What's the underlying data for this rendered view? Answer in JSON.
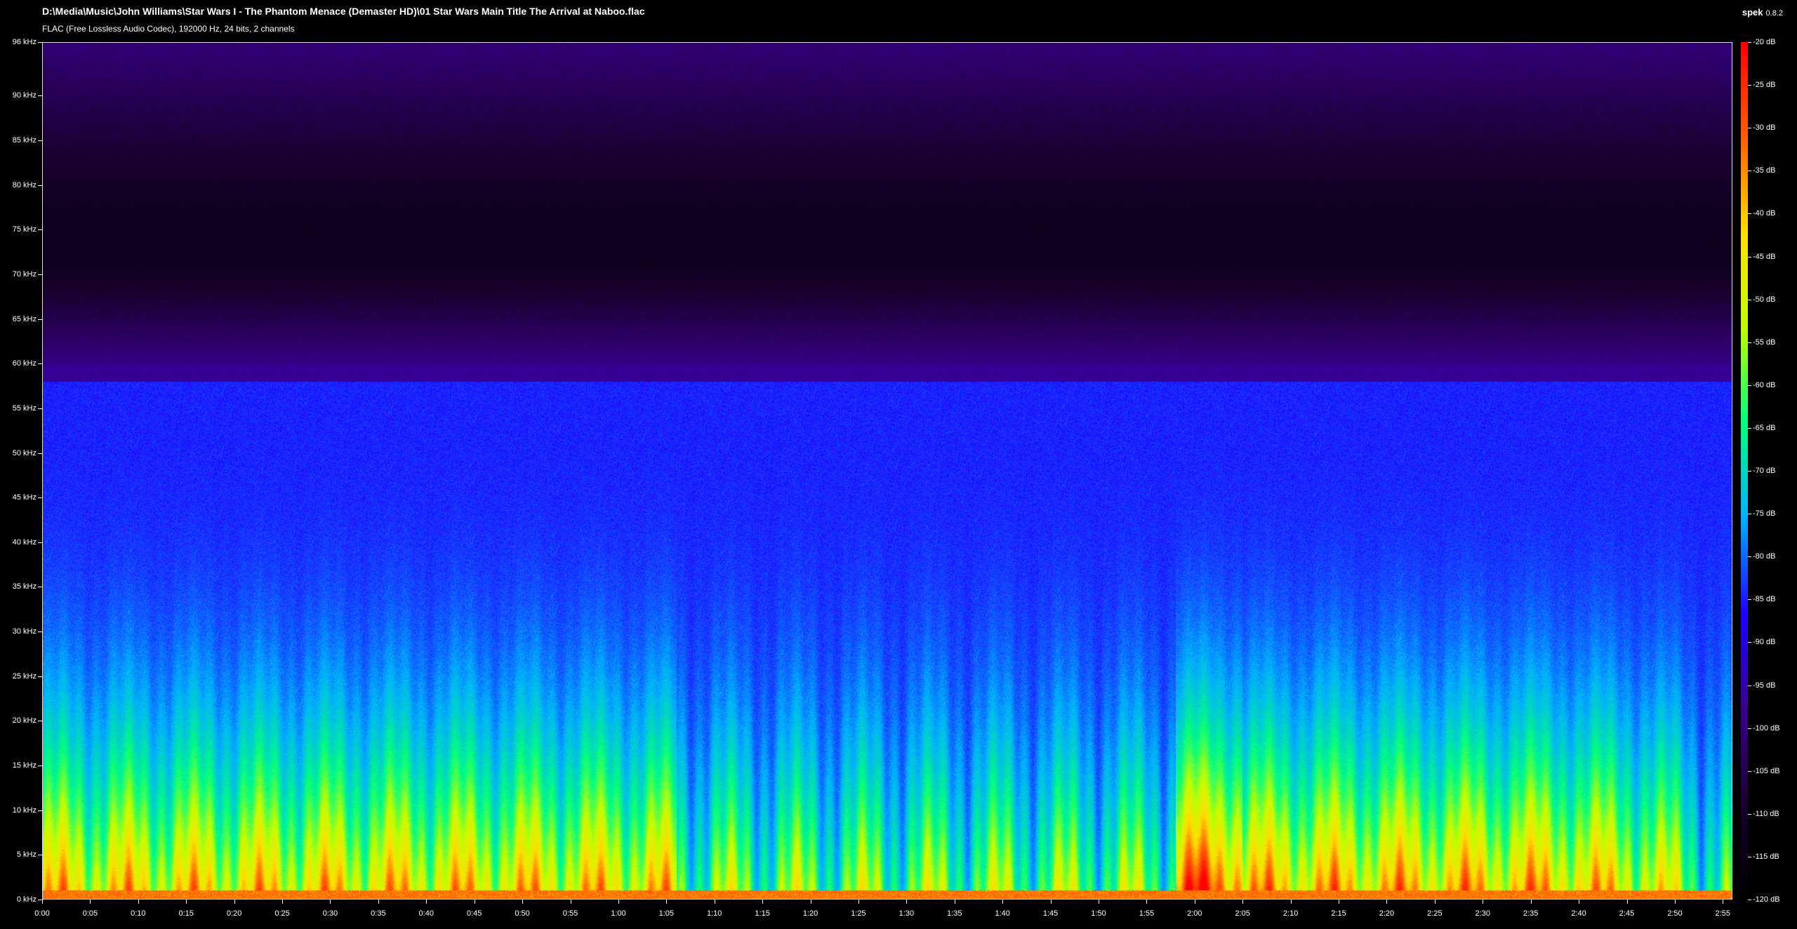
{
  "header": {
    "file_path": "D:\\Media\\Music\\John Williams\\Star Wars I - The Phantom Menace (Demaster HD)\\01 Star Wars Main Title  The Arrival at Naboo.flac",
    "file_info": "FLAC (Free Lossless Audio Codec), 192000 Hz, 24 bits, 2 channels",
    "app_name": "spek",
    "app_version": "0.8.2"
  },
  "colors": {
    "background": "#000000",
    "spectrum_scale": [
      "#000000",
      "#1a0030",
      "#3a0090",
      "#2000ff",
      "#00b0ff",
      "#00ff80",
      "#c0ff00",
      "#ffe000",
      "#ff6000",
      "#ff0000"
    ]
  },
  "chart_data": {
    "type": "heatmap",
    "x_axis_labels": [
      "0:00",
      "0:05",
      "0:10",
      "0:15",
      "0:20",
      "0:25",
      "0:30",
      "0:35",
      "0:40",
      "0:45",
      "0:50",
      "0:55",
      "1:00",
      "1:05",
      "1:10",
      "1:15",
      "1:20",
      "1:25",
      "1:30",
      "1:35",
      "1:40",
      "1:45",
      "1:50",
      "1:55",
      "2:00",
      "2:05",
      "2:10",
      "2:15",
      "2:20",
      "2:25",
      "2:30",
      "2:35",
      "2:40",
      "2:45",
      "2:50",
      "2:55"
    ],
    "x_range_seconds": [
      0,
      176
    ],
    "y_axis_labels": [
      "0 kHz",
      "5 kHz",
      "10 kHz",
      "15 kHz",
      "20 kHz",
      "25 kHz",
      "30 kHz",
      "35 kHz",
      "40 kHz",
      "45 kHz",
      "50 kHz",
      "55 kHz",
      "60 kHz",
      "65 kHz",
      "70 kHz",
      "75 kHz",
      "80 kHz",
      "85 kHz",
      "90 kHz",
      "96 kHz"
    ],
    "y_values_khz": [
      0,
      5,
      10,
      15,
      20,
      25,
      30,
      35,
      40,
      45,
      50,
      55,
      60,
      65,
      70,
      75,
      80,
      85,
      90,
      96
    ],
    "ylim_khz": [
      0,
      96
    ],
    "colorbar_labels": [
      "-20 dB",
      "-25 dB",
      "-30 dB",
      "-35 dB",
      "-40 dB",
      "-45 dB",
      "-50 dB",
      "-55 dB",
      "-60 dB",
      "-65 dB",
      "-70 dB",
      "-75 dB",
      "-80 dB",
      "-85 dB",
      "-90 dB",
      "-95 dB",
      "-100 dB",
      "-105 dB",
      "-110 dB",
      "-115 dB",
      "-120 dB"
    ],
    "colorbar_values_db": [
      -20,
      -25,
      -30,
      -35,
      -40,
      -45,
      -50,
      -55,
      -60,
      -65,
      -70,
      -75,
      -80,
      -85,
      -90,
      -95,
      -100,
      -105,
      -110,
      -115,
      -120
    ],
    "db_range": [
      -120,
      -20
    ],
    "content_cutoff_khz": 58
  }
}
